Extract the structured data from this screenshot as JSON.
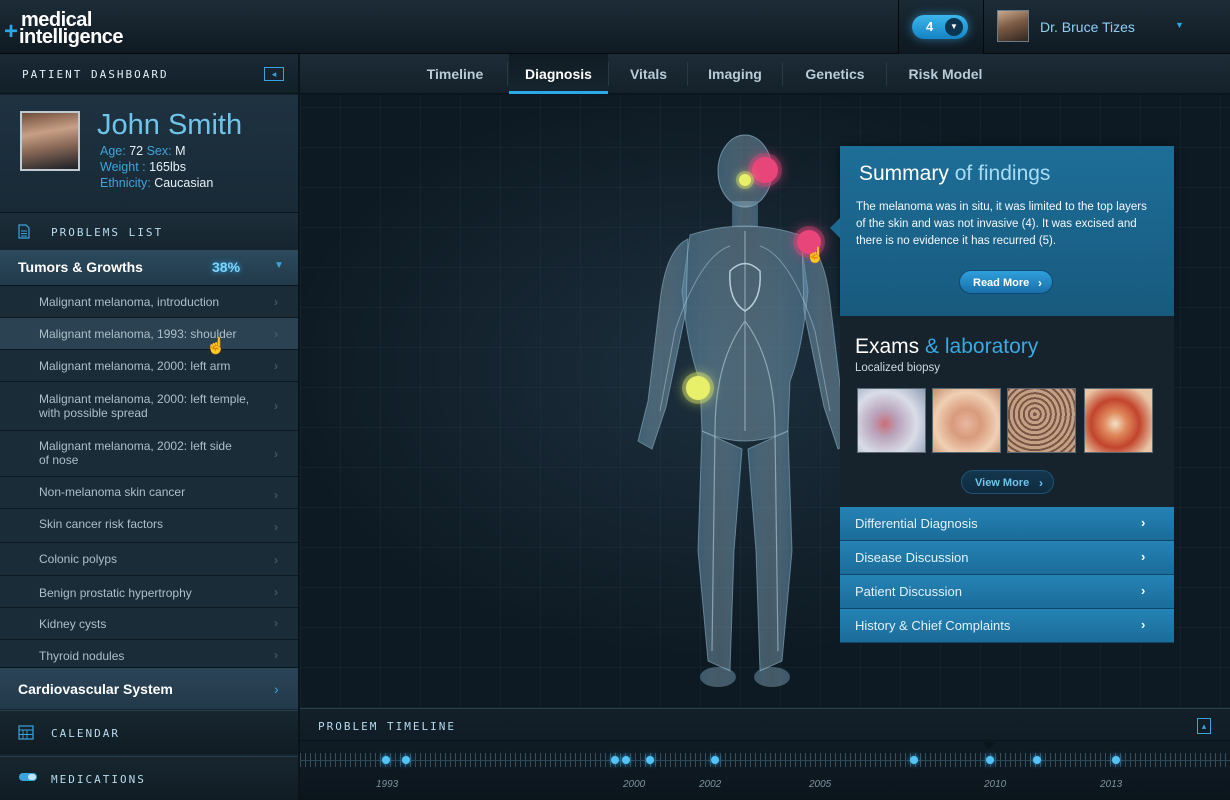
{
  "app": {
    "logo_line1": "medical",
    "logo_line2": "intelligence",
    "logo_plus": "+",
    "notification_count": "4",
    "user_name": "Dr. Bruce Tizes"
  },
  "colors": {
    "accent": "#2aa8e8",
    "background": "#0e1a23",
    "panel_blue": "#1d6e98",
    "marker_red": "#e8457a",
    "marker_yellow": "#e8f06a"
  },
  "sidebar": {
    "title": "PATIENT DASHBOARD",
    "patient": {
      "name": "John Smith",
      "age_label": "Age:",
      "age": "72",
      "sex_label": "Sex:",
      "sex": "M",
      "weight_label": "Weight :",
      "weight": "165lbs",
      "ethnicity_label": "Ethnicity:",
      "ethnicity": "Caucasian"
    },
    "problems_label": "PROBLEMS LIST",
    "group": {
      "title": "Tumors & Growths",
      "percent": "38%"
    },
    "items": [
      {
        "label": "Malignant melanoma, introduction"
      },
      {
        "label": "Malignant melanoma, 1993: shoulder"
      },
      {
        "label": "Malignant melanoma, 2000: left arm"
      },
      {
        "label": "Malignant melanoma, 2000: left temple, with possible spread"
      },
      {
        "label": "Malignant melanoma, 2002: left side of nose"
      },
      {
        "label": "Non-melanoma skin cancer"
      },
      {
        "label": "Skin cancer risk factors"
      },
      {
        "label": "Colonic polyps"
      },
      {
        "label": "Benign prostatic hypertrophy"
      },
      {
        "label": "Kidney cysts"
      },
      {
        "label": "Thyroid nodules"
      }
    ],
    "selected_index": 1,
    "cardio_label": "Cardiovascular System",
    "calendar_label": "CALENDAR",
    "medications_label": "MEDICATIONS"
  },
  "tabs": [
    {
      "label": "Timeline"
    },
    {
      "label": "Diagnosis",
      "active": true
    },
    {
      "label": "Vitals"
    },
    {
      "label": "Imaging"
    },
    {
      "label": "Genetics"
    },
    {
      "label": "Risk Model"
    }
  ],
  "summary": {
    "title_main": "Summary",
    "title_highlight": "of findings",
    "text": "The melanoma was in situ,  it was limited to the top layers of the skin and was not invasive (4). It was excised and there is no evidence it has recurred (5).",
    "read_more": "Read More"
  },
  "exams": {
    "title_main": "Exams",
    "title_highlight": "& laboratory",
    "subtitle": "Localized biopsy",
    "view_more": "View More"
  },
  "detail_rows": [
    {
      "label": "Differential Diagnosis"
    },
    {
      "label": "Disease Discussion"
    },
    {
      "label": "Patient Discussion"
    },
    {
      "label": "History & Chief Complaints"
    }
  ],
  "timeline": {
    "title": "PROBLEM TIMELINE",
    "years": [
      "1993",
      "2000",
      "2002",
      "2005",
      "2010",
      "2013"
    ]
  }
}
